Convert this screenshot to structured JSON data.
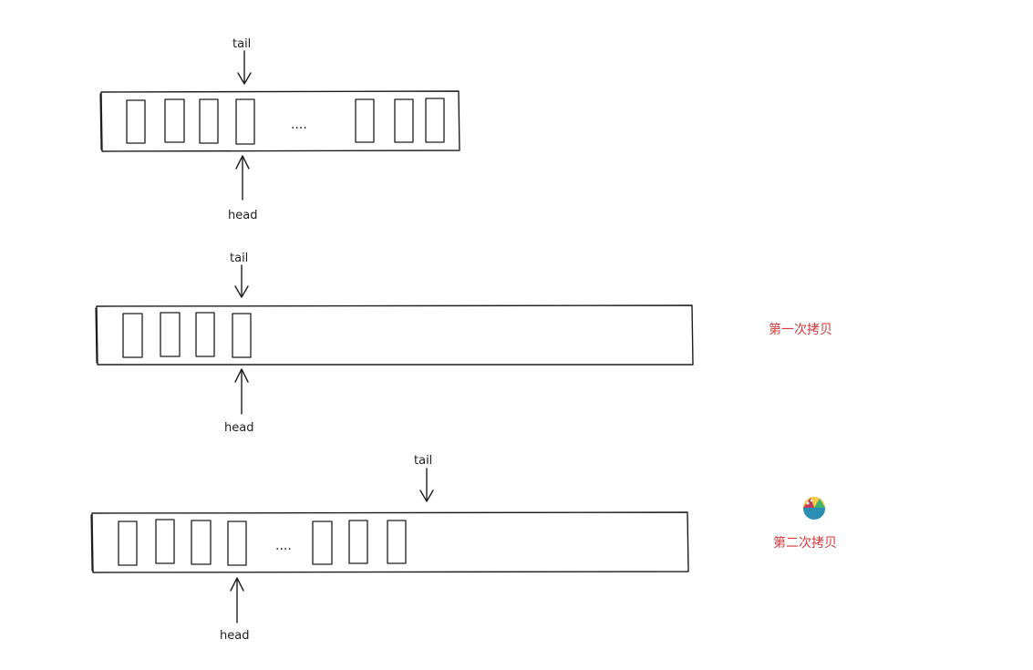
{
  "diagram": {
    "label_color": "#d63a3a",
    "stroke_color": "#1e1e1e",
    "rows": [
      {
        "tail_label": "tail",
        "head_label": "head",
        "ellipsis": "....",
        "note": ""
      },
      {
        "tail_label": "tail",
        "head_label": "head",
        "ellipsis": "",
        "note": "第一次拷贝"
      },
      {
        "tail_label": "tail",
        "head_label": "head",
        "ellipsis": "....",
        "note": "第二次拷贝"
      }
    ],
    "logo_icon": "colorful-bowl-logo-icon"
  }
}
